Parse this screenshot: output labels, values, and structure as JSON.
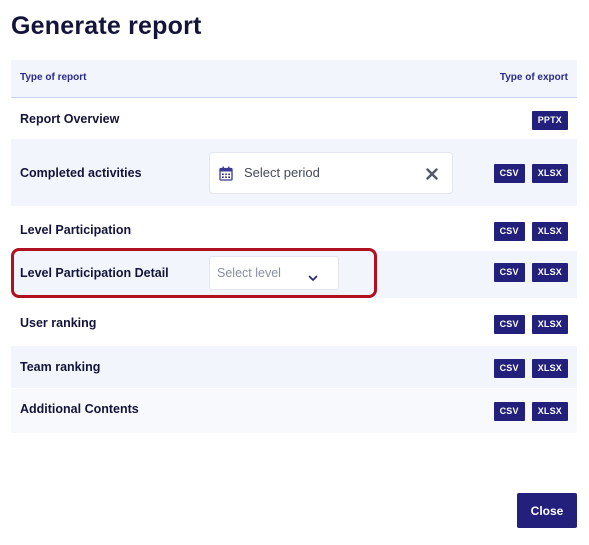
{
  "modal": {
    "title": "Generate report",
    "close_label": "Close"
  },
  "table": {
    "col_report": "Type of report",
    "col_export": "Type of export",
    "rows": [
      {
        "label": "Report Overview",
        "exports": [
          "PPTX"
        ]
      },
      {
        "label": "Completed activities",
        "exports": [
          "CSV",
          "XLSX"
        ],
        "period_placeholder": "Select period"
      },
      {
        "label": "Level Participation",
        "exports": [
          "CSV",
          "XLSX"
        ]
      },
      {
        "label": "Level Participation Detail",
        "exports": [
          "CSV",
          "XLSX"
        ],
        "level_placeholder": "Select level"
      },
      {
        "label": "User ranking",
        "exports": [
          "CSV",
          "XLSX"
        ]
      },
      {
        "label": "Team ranking",
        "exports": [
          "CSV",
          "XLSX"
        ]
      },
      {
        "label": "Additional Contents",
        "exports": [
          "CSV",
          "XLSX"
        ]
      }
    ]
  },
  "colors": {
    "primary": "#22207a",
    "row_alt": "#f2f6fc",
    "highlight": "#b01020",
    "text": "#14143a"
  },
  "icons": [
    "calendar-icon",
    "close-icon",
    "chevron-down-icon"
  ]
}
